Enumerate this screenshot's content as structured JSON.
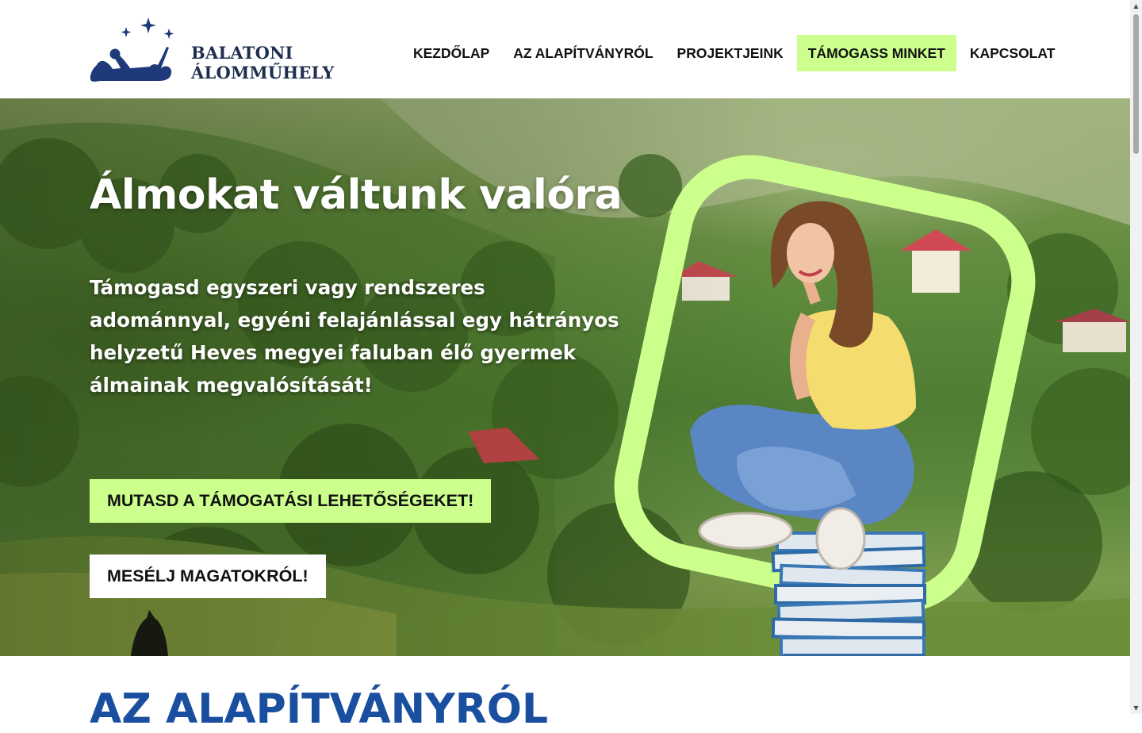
{
  "brand": {
    "line1": "BALATONI",
    "line2": "ÁLOMMŰHELY",
    "logo_icon": "dreaming-person-stars-icon",
    "color": "#1f3a7a"
  },
  "nav": {
    "items": [
      {
        "label": "KEZDŐLAP",
        "active": false
      },
      {
        "label": "AZ ALAPÍTVÁNYRÓL",
        "active": false
      },
      {
        "label": "PROJEKTJEINK",
        "active": false
      },
      {
        "label": "TÁMOGASS MINKET",
        "active": true
      },
      {
        "label": "KAPCSOLAT",
        "active": false
      }
    ]
  },
  "hero": {
    "title": "Álmokat váltunk valóra",
    "text": "Támogasd egyszeri vagy rendszeres adománnyal, egyéni felajánlással egy hátrányos helyzetű Heves megyei faluban élő gyermek álmainak megvalósítását!",
    "primary_button": "MUTASD A TÁMOGATÁSI LEHETŐSÉGEKET!",
    "secondary_button": "MESÉLJ MAGATOKRÓL!",
    "image": "girl-sitting-on-books-icon"
  },
  "next_section": {
    "heading": "AZ ALAPÍTVÁNYRÓL"
  },
  "colors": {
    "accent": "#ccff8c",
    "heading_blue": "#1a4fa0",
    "text_dark": "#111111"
  }
}
